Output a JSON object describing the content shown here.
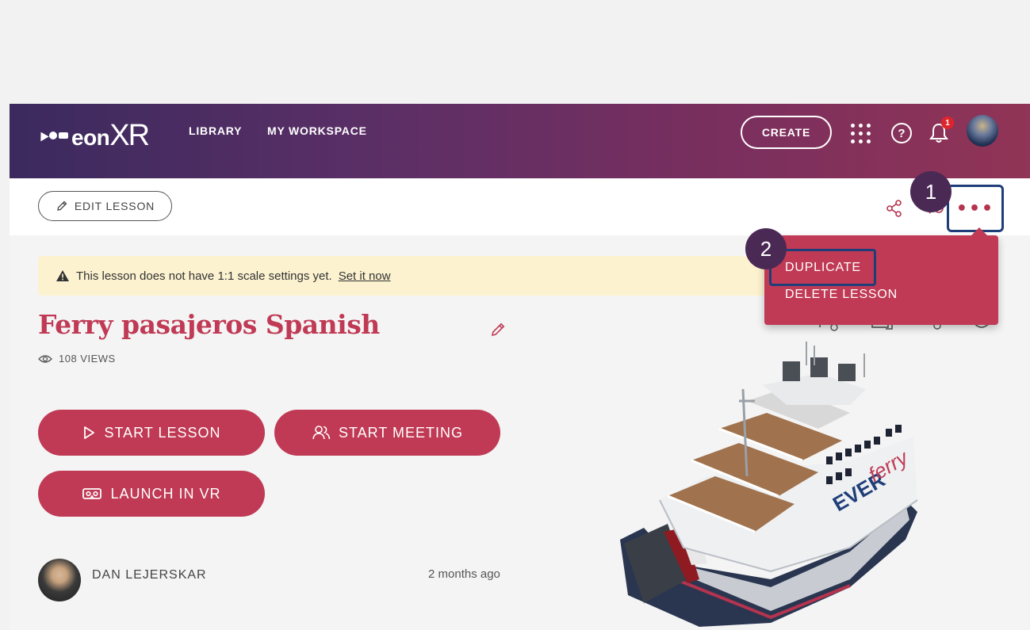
{
  "header": {
    "logo_text": "eon",
    "logo_text_big": "XR",
    "nav_library": "LIBRARY",
    "nav_workspace": "MY WORKSPACE",
    "create_label": "CREATE",
    "help_glyph": "?",
    "notification_count": "1",
    "icons": [
      "apps-grid-icon",
      "help-icon",
      "bell-icon",
      "user-avatar"
    ]
  },
  "toolbar": {
    "edit_lesson_label": "EDIT LESSON",
    "more_label": "•••",
    "icons": [
      "pencil-icon",
      "share-icon",
      "more-icon"
    ]
  },
  "callouts": {
    "step1": "1",
    "step2": "2"
  },
  "dropdown": {
    "items": [
      {
        "label": "DUPLICATE"
      },
      {
        "label": "DELETE LESSON"
      }
    ]
  },
  "warning": {
    "text": "This lesson does not have 1:1 scale settings yet.",
    "link": "Set it now"
  },
  "lesson": {
    "title": "Ferry pasajeros Spanish",
    "views": "108 VIEWS",
    "buttons": {
      "start_lesson": "START LESSON",
      "start_meeting": "START MEETING",
      "launch_vr": "LAUNCH IN VR"
    },
    "author": "DAN LEJERSKAR",
    "time": "2 months ago"
  },
  "colors": {
    "accent": "#c03a55",
    "highlight_border": "#1f3e79",
    "callout": "#4a2a55",
    "warning_bg": "#fcf2d0"
  }
}
